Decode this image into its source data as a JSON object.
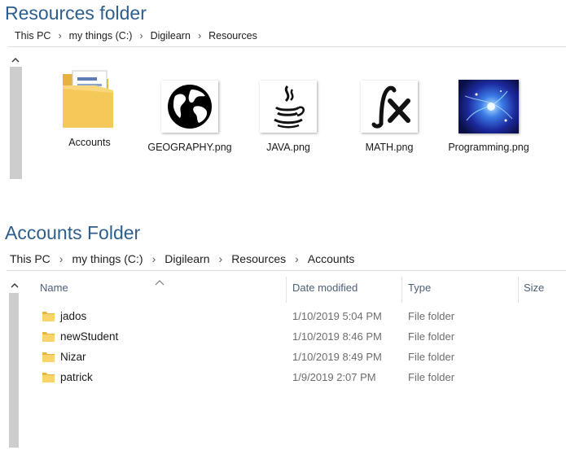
{
  "resources_section": {
    "heading": "Resources folder",
    "breadcrumb": [
      "This PC",
      "my things (C:)",
      "Digilearn",
      "Resources"
    ],
    "items": [
      {
        "label": "Accounts",
        "icon": "folder-icon"
      },
      {
        "label": "GEOGRAPHY.png",
        "icon": "globe-icon"
      },
      {
        "label": "JAVA.png",
        "icon": "java-icon"
      },
      {
        "label": "MATH.png",
        "icon": "function-icon"
      },
      {
        "label": "Programming.png",
        "icon": "programming-image"
      }
    ]
  },
  "accounts_section": {
    "heading": "Accounts Folder",
    "breadcrumb": [
      "This PC",
      "my things (C:)",
      "Digilearn",
      "Resources",
      "Accounts"
    ],
    "columns": {
      "name": "Name",
      "date": "Date modified",
      "type": "Type",
      "size": "Size"
    },
    "rows": [
      {
        "name": "jados",
        "date": "1/10/2019 5:04 PM",
        "type": "File folder"
      },
      {
        "name": "newStudent",
        "date": "1/10/2019 8:46 PM",
        "type": "File folder"
      },
      {
        "name": "Nizar",
        "date": "1/10/2019 8:49 PM",
        "type": "File folder"
      },
      {
        "name": "patrick",
        "date": "1/9/2019 2:07 PM",
        "type": "File folder"
      }
    ]
  },
  "colors": {
    "heading": "#2e5e8c",
    "folder": "#f5c85a",
    "scrollbar": "#cdcdcd"
  }
}
